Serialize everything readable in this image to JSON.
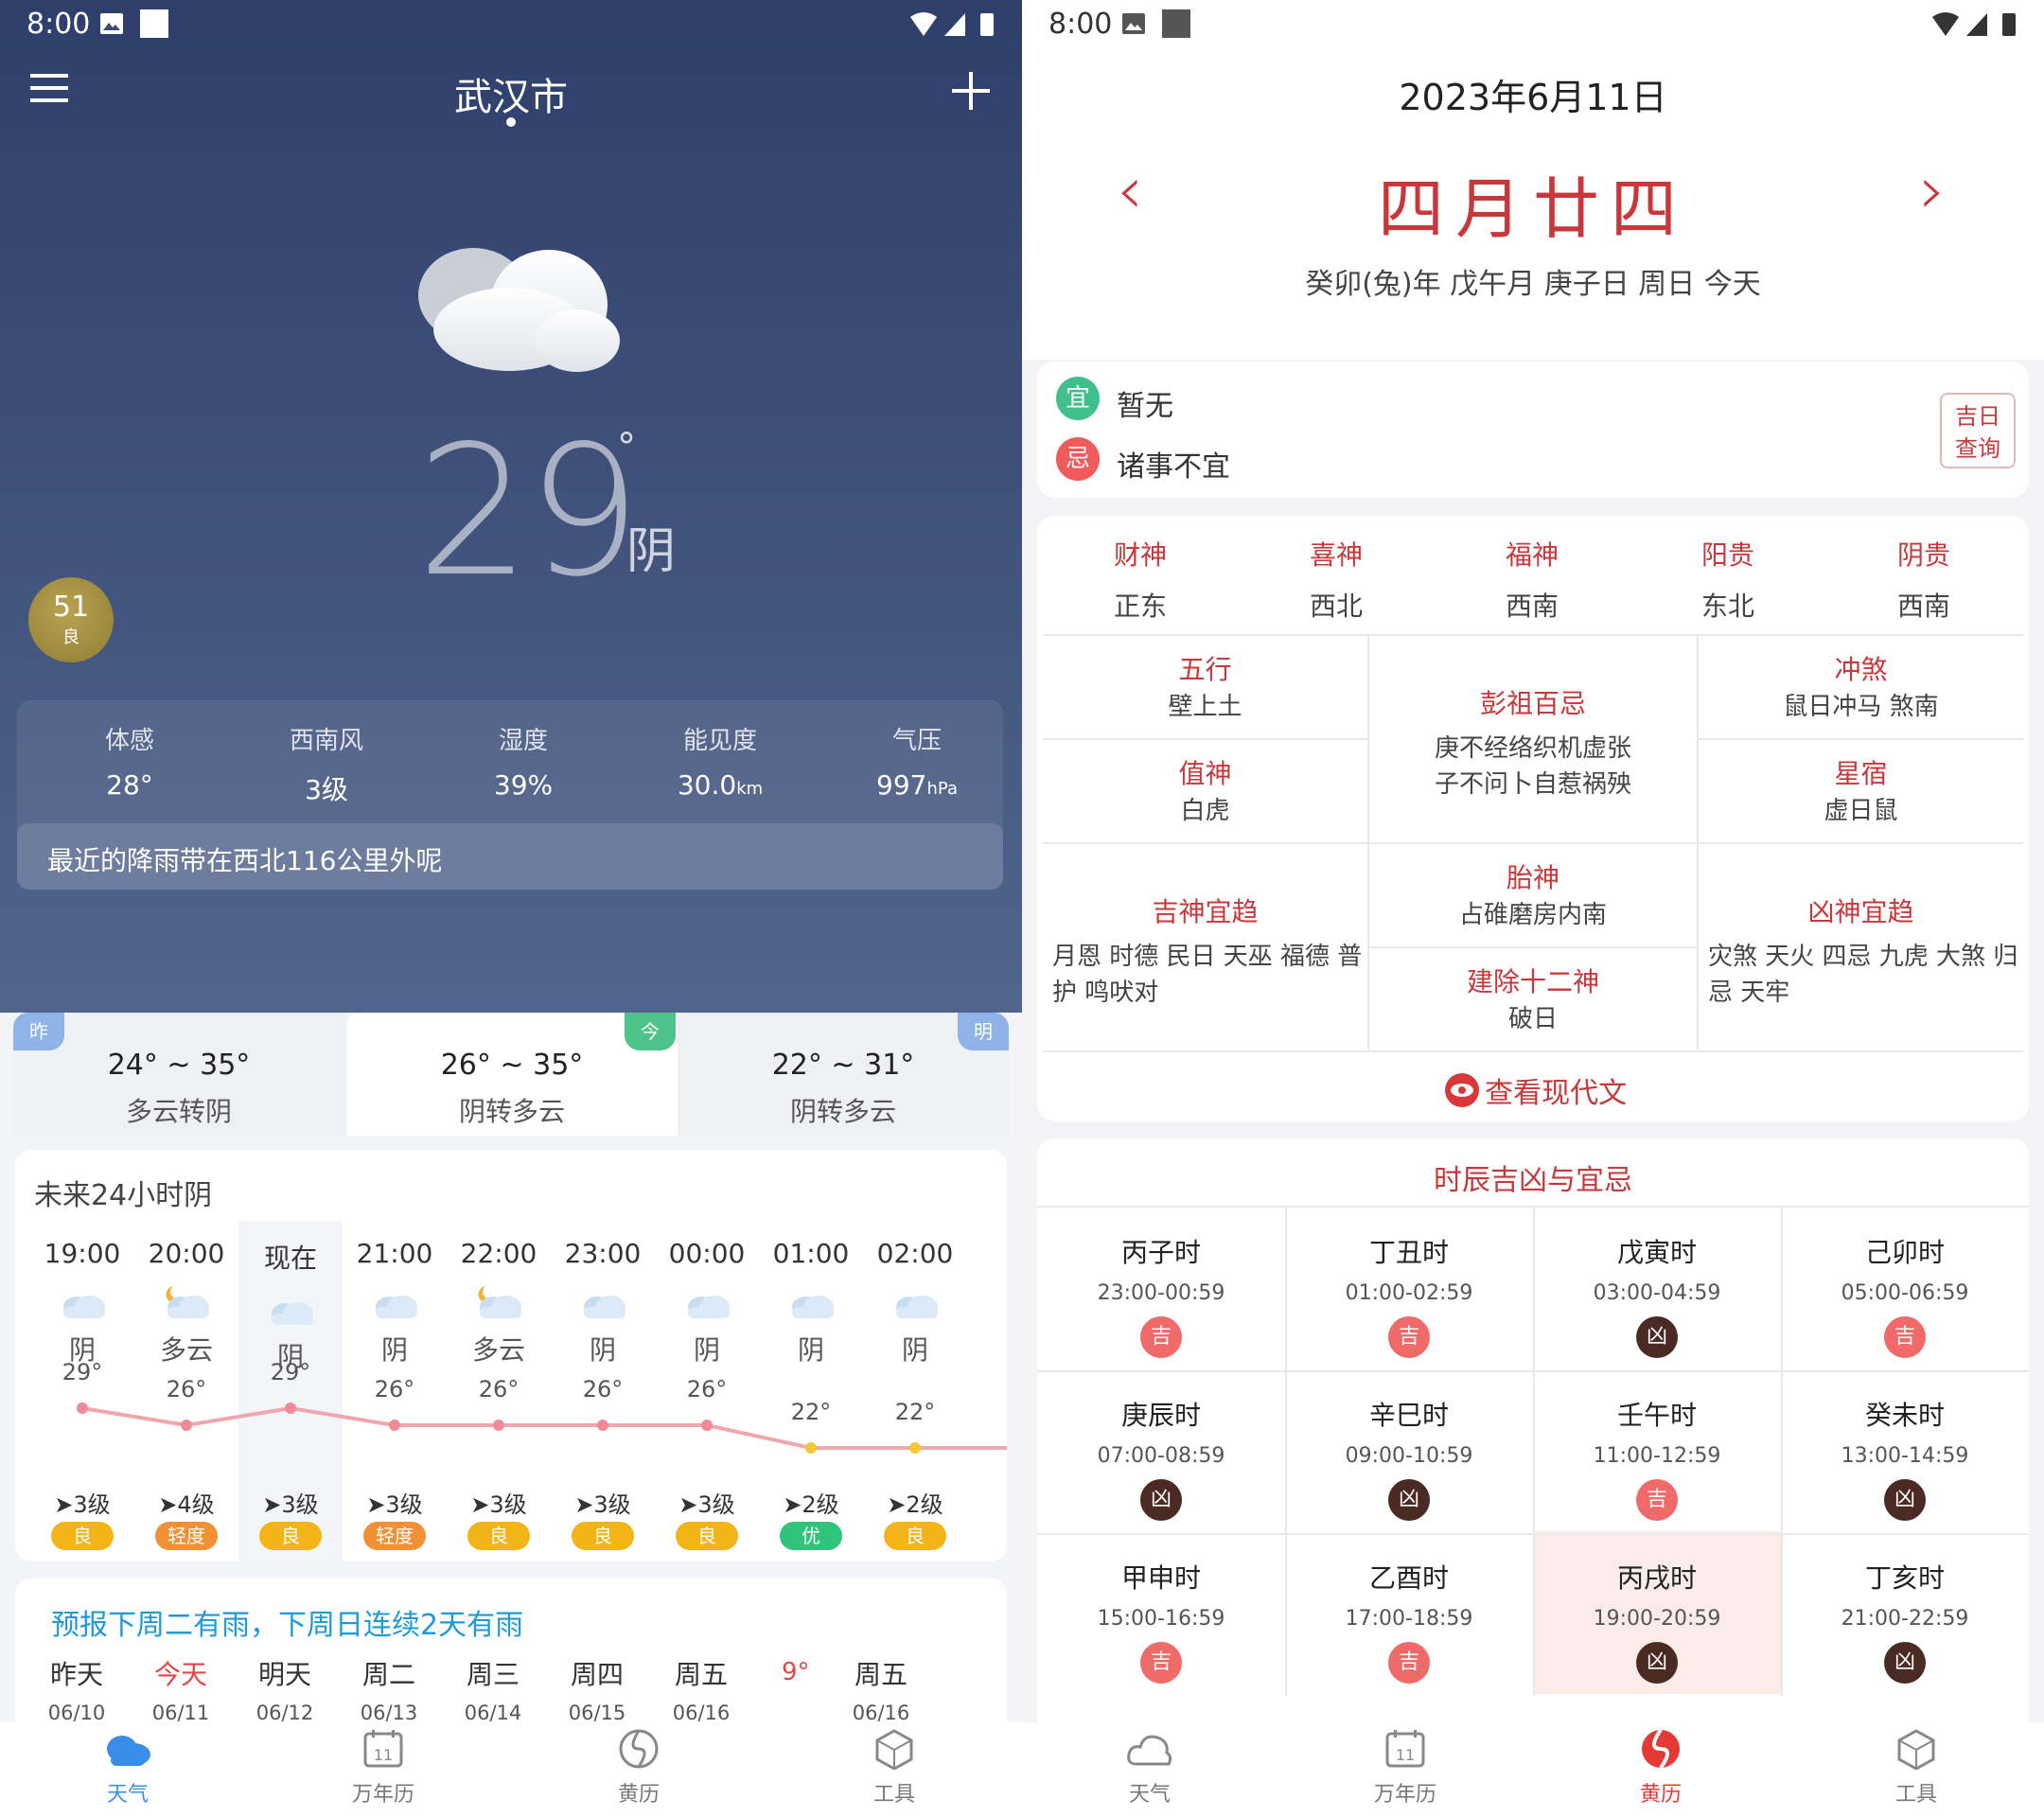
{
  "left": {
    "status_time": "8:00",
    "city": "武汉市",
    "temperature": "29",
    "degree_symbol": "°",
    "condition": "阴",
    "aqi": {
      "value": "51",
      "level": "良"
    },
    "stats": [
      {
        "title": "体感",
        "value": "28°",
        "unit": ""
      },
      {
        "title": "西南风",
        "value": "3级",
        "unit": ""
      },
      {
        "title": "湿度",
        "value": "39%",
        "unit": ""
      },
      {
        "title": "能见度",
        "value": "30.0",
        "unit": "km"
      },
      {
        "title": "气压",
        "value": "997",
        "unit": "hPa"
      }
    ],
    "rain_notice": "最近的降雨带在西北116公里外呢",
    "days": [
      {
        "tag": "昨",
        "range": "24° ~ 35°",
        "cond": "多云转阴"
      },
      {
        "tag": "今",
        "range": "26° ~ 35°",
        "cond": "阴转多云"
      },
      {
        "tag": "明",
        "range": "22° ~ 31°",
        "cond": "阴转多云"
      }
    ],
    "hourly_title": "未来24小时阴",
    "hourly": [
      {
        "time": "19:00",
        "cond": "阴",
        "temp": "29°",
        "wind": "3级",
        "aqi": "良",
        "aqi_color": "#f3b417"
      },
      {
        "time": "20:00",
        "cond": "多云",
        "temp": "26°",
        "wind": "4级",
        "aqi": "轻度",
        "aqi_color": "#f19035"
      },
      {
        "time": "现在",
        "cond": "阴",
        "temp": "29°",
        "wind": "3级",
        "aqi": "良",
        "aqi_color": "#f3b417"
      },
      {
        "time": "21:00",
        "cond": "阴",
        "temp": "26°",
        "wind": "3级",
        "aqi": "轻度",
        "aqi_color": "#f19035"
      },
      {
        "time": "22:00",
        "cond": "多云",
        "temp": "26°",
        "wind": "3级",
        "aqi": "良",
        "aqi_color": "#f3b417"
      },
      {
        "time": "23:00",
        "cond": "阴",
        "temp": "26°",
        "wind": "3级",
        "aqi": "良",
        "aqi_color": "#f3b417"
      },
      {
        "time": "00:00",
        "cond": "阴",
        "temp": "26°",
        "wind": "3级",
        "aqi": "良",
        "aqi_color": "#f3b417"
      },
      {
        "time": "01:00",
        "cond": "阴",
        "temp": "22°",
        "wind": "2级",
        "aqi": "优",
        "aqi_color": "#2fc47a"
      },
      {
        "time": "02:00",
        "cond": "阴",
        "temp": "22°",
        "wind": "2级",
        "aqi": "良",
        "aqi_color": "#f3b417"
      }
    ],
    "forecast_title": "预报下周二有雨，下周日连续2天有雨",
    "forecast_days": [
      {
        "name": "昨天",
        "date": "06/10"
      },
      {
        "name": "今天",
        "date": "06/11"
      },
      {
        "name": "明天",
        "date": "06/12"
      },
      {
        "name": "周二",
        "date": "06/13"
      },
      {
        "name": "周三",
        "date": "06/14"
      },
      {
        "name": "周四",
        "date": "06/15"
      },
      {
        "name": "周五",
        "date": "06/16"
      },
      {
        "name": "周五",
        "date": "06/16"
      }
    ],
    "forecast_extra_temp": "9°",
    "tabs": [
      "天气",
      "万年历",
      "黄历",
      "工具"
    ]
  },
  "right": {
    "status_time": "8:00",
    "date": "2023年6月11日",
    "lunar": "四月廿四",
    "ganzhi": "癸卯(兔)年  戊午月  庚子日  周日  今天",
    "yi_label": "宜",
    "yi_text": "暂无",
    "ji_label": "忌",
    "ji_text": "诸事不宜",
    "jiri_btn": [
      "吉日",
      "查询"
    ],
    "gods": [
      {
        "title": "财神",
        "value": "正东"
      },
      {
        "title": "喜神",
        "value": "西北"
      },
      {
        "title": "福神",
        "value": "西南"
      },
      {
        "title": "阳贵",
        "value": "东北"
      },
      {
        "title": "阴贵",
        "value": "西南"
      }
    ],
    "wuxing": {
      "title": "五行",
      "value": "壁上土"
    },
    "zhishen": {
      "title": "值神",
      "value": "白虎"
    },
    "pengzu": {
      "title": "彭祖百忌",
      "value1": "庚不经络织机虚张",
      "value2": "子不问卜自惹祸殃"
    },
    "chongsha": {
      "title": "冲煞",
      "value": "鼠日冲马 煞南"
    },
    "xingxiu": {
      "title": "星宿",
      "value": "虚日鼠"
    },
    "jishen": {
      "title": "吉神宜趋",
      "value1": "月恩 时德 民日 天巫 福德 普",
      "value2": "护 鸣吠对"
    },
    "taishen": {
      "title": "胎神",
      "value": "占碓磨房内南"
    },
    "jianchu": {
      "title": "建除十二神",
      "value": "破日"
    },
    "xiongshen": {
      "title": "凶神宜趋",
      "value1": "灾煞 天火 四忌 九虎 大煞 归",
      "value2": "忌 天牢"
    },
    "modern_text": "查看现代文",
    "hour_title": "时辰吉凶与宜忌",
    "hours": [
      {
        "name": "丙子时",
        "time": "23:00-00:59",
        "luck": "吉"
      },
      {
        "name": "丁丑时",
        "time": "01:00-02:59",
        "luck": "吉"
      },
      {
        "name": "戊寅时",
        "time": "03:00-04:59",
        "luck": "凶"
      },
      {
        "name": "己卯时",
        "time": "05:00-06:59",
        "luck": "吉"
      },
      {
        "name": "庚辰时",
        "time": "07:00-08:59",
        "luck": "凶"
      },
      {
        "name": "辛巳时",
        "time": "09:00-10:59",
        "luck": "凶"
      },
      {
        "name": "壬午时",
        "time": "11:00-12:59",
        "luck": "吉"
      },
      {
        "name": "癸未时",
        "time": "13:00-14:59",
        "luck": "凶"
      },
      {
        "name": "甲申时",
        "time": "15:00-16:59",
        "luck": "吉"
      },
      {
        "name": "乙酉时",
        "time": "17:00-18:59",
        "luck": "吉"
      },
      {
        "name": "丙戌时",
        "time": "19:00-20:59",
        "luck": "凶"
      },
      {
        "name": "丁亥时",
        "time": "21:00-22:59",
        "luck": "凶"
      }
    ],
    "tabs": [
      "天气",
      "万年历",
      "黄历",
      "工具"
    ]
  },
  "colors": {
    "accent_red": "#c8373a",
    "ji_badge": "#f06a6a",
    "xiong_badge": "#4a2a22",
    "weather_blue": "#1e9ad6"
  }
}
